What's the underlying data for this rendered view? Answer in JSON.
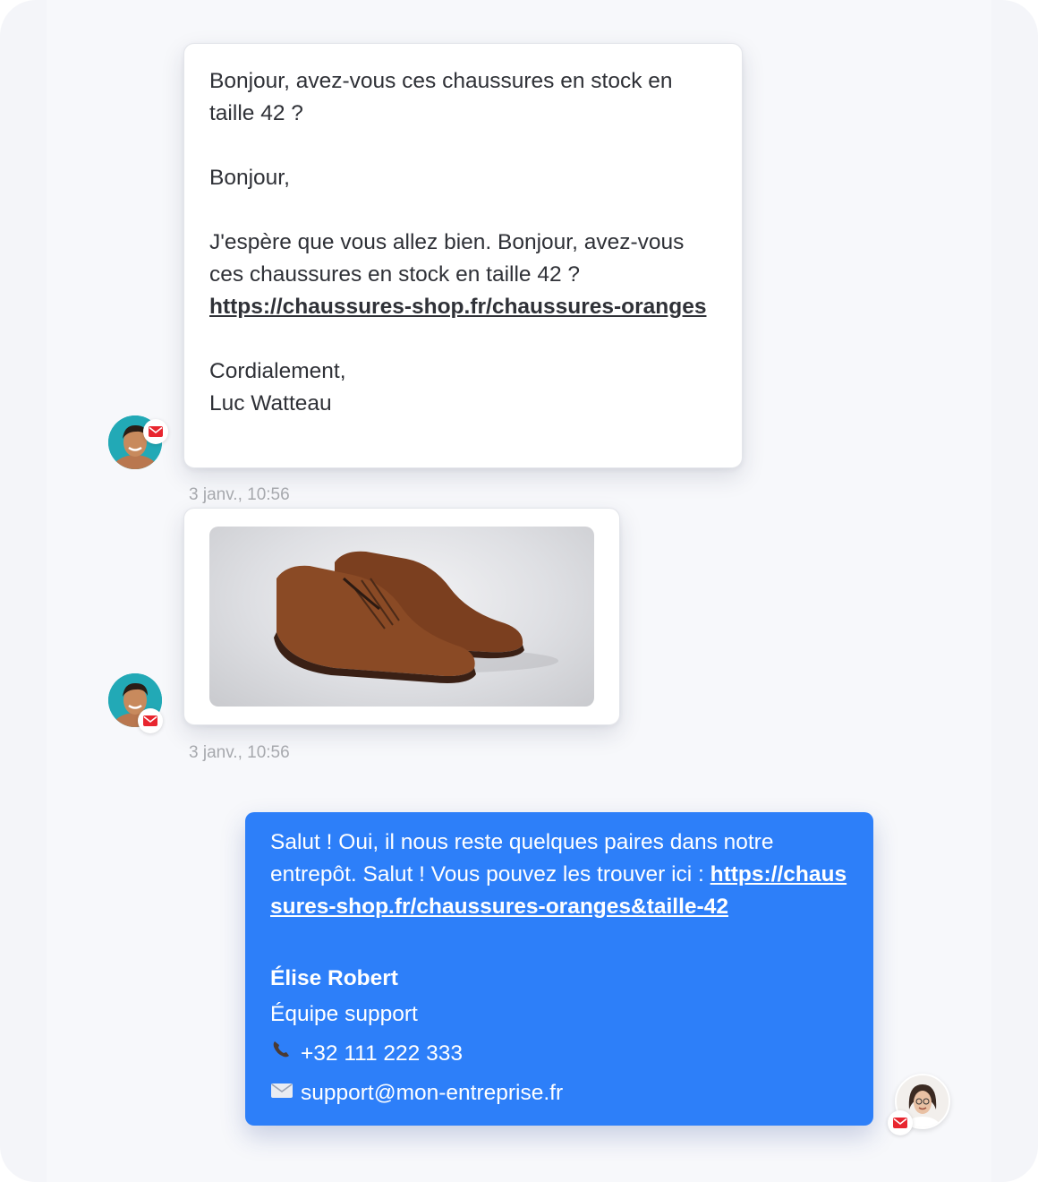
{
  "messages": [
    {
      "sender": "customer",
      "lines": {
        "l1": "Bonjour, avez-vous ces chaussures en stock en taille 42 ?",
        "l2": "Bonjour,",
        "l3": "J'espère que vous allez bien. Bonjour, avez-vous ces chaussures en stock en taille 42 ?",
        "link": "https://chaussures-shop.fr/chaussures-oranges",
        "l4": "Cordialement,",
        "l5": "Luc Watteau"
      },
      "timestamp": "3 janv., 10:56"
    },
    {
      "sender": "customer",
      "attachment": "image of brown suede brogue shoes",
      "timestamp": "3 janv., 10:56"
    },
    {
      "sender": "agent",
      "text": "Salut ! Oui, il nous reste quelques paires dans notre entrepôt. Salut ! Vous pouvez les trouver ici : ",
      "link": "https://chaussures-shop.fr/chaussures-oranges&taille-42",
      "signature": {
        "name": "Élise Robert",
        "team": "Équipe support",
        "phone": "+32 111 222 333",
        "email": "support@mon-entreprise.fr"
      }
    }
  ],
  "icons": {
    "channel": "mail-icon",
    "phone": "phone-icon",
    "envelope": "envelope-icon"
  },
  "colors": {
    "agent_bubble": "#2d7ff9",
    "mail_badge": "#e8262f",
    "timestamp": "#a7a9ae"
  }
}
